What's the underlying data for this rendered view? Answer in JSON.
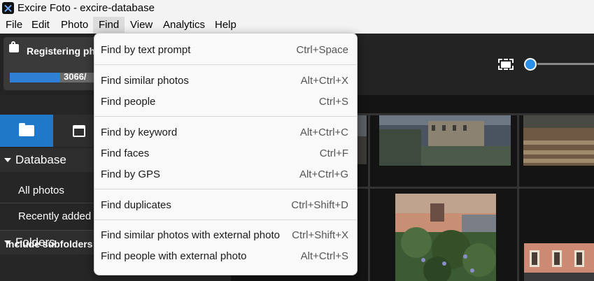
{
  "window": {
    "title": "Excire Foto - excire-database"
  },
  "menubar": {
    "items": [
      {
        "label": "File"
      },
      {
        "label": "Edit"
      },
      {
        "label": "Photo"
      },
      {
        "label": "Find"
      },
      {
        "label": "View"
      },
      {
        "label": "Analytics"
      },
      {
        "label": "Help"
      }
    ],
    "active": "Find"
  },
  "toolbar": {
    "registering_label": "Registering ph",
    "progress_text": "3066/",
    "progress_fraction": 0.55
  },
  "sidebar": {
    "tabs": [
      {
        "icon": "folder-icon",
        "active": true
      },
      {
        "icon": "calendar-icon"
      }
    ],
    "database_header": "Database",
    "database_items": [
      {
        "label": "All photos"
      },
      {
        "label": "Recently added"
      }
    ],
    "folders_header": "Folders",
    "include_subfolders_label": "Include subfolders",
    "include_subfolders_on": true
  },
  "find_menu": {
    "groups": [
      [
        {
          "label": "Find by text prompt",
          "shortcut": "Ctrl+Space"
        }
      ],
      [
        {
          "label": "Find similar photos",
          "shortcut": "Alt+Ctrl+X"
        },
        {
          "label": "Find people",
          "shortcut": "Ctrl+S"
        }
      ],
      [
        {
          "label": "Find by keyword",
          "shortcut": "Alt+Ctrl+C"
        },
        {
          "label": "Find faces",
          "shortcut": "Ctrl+F"
        },
        {
          "label": "Find by GPS",
          "shortcut": "Alt+Ctrl+G"
        }
      ],
      [
        {
          "label": "Find duplicates",
          "shortcut": "Ctrl+Shift+D"
        }
      ],
      [
        {
          "label": "Find similar photos with external photo",
          "shortcut": "Ctrl+Shift+X"
        },
        {
          "label": "Find people with external photo",
          "shortcut": "Alt+Ctrl+S"
        }
      ]
    ]
  },
  "colors": {
    "accent": "#1f78c8",
    "dark_bg": "#1e1e1e",
    "menu_bg": "#f9f9f9"
  }
}
